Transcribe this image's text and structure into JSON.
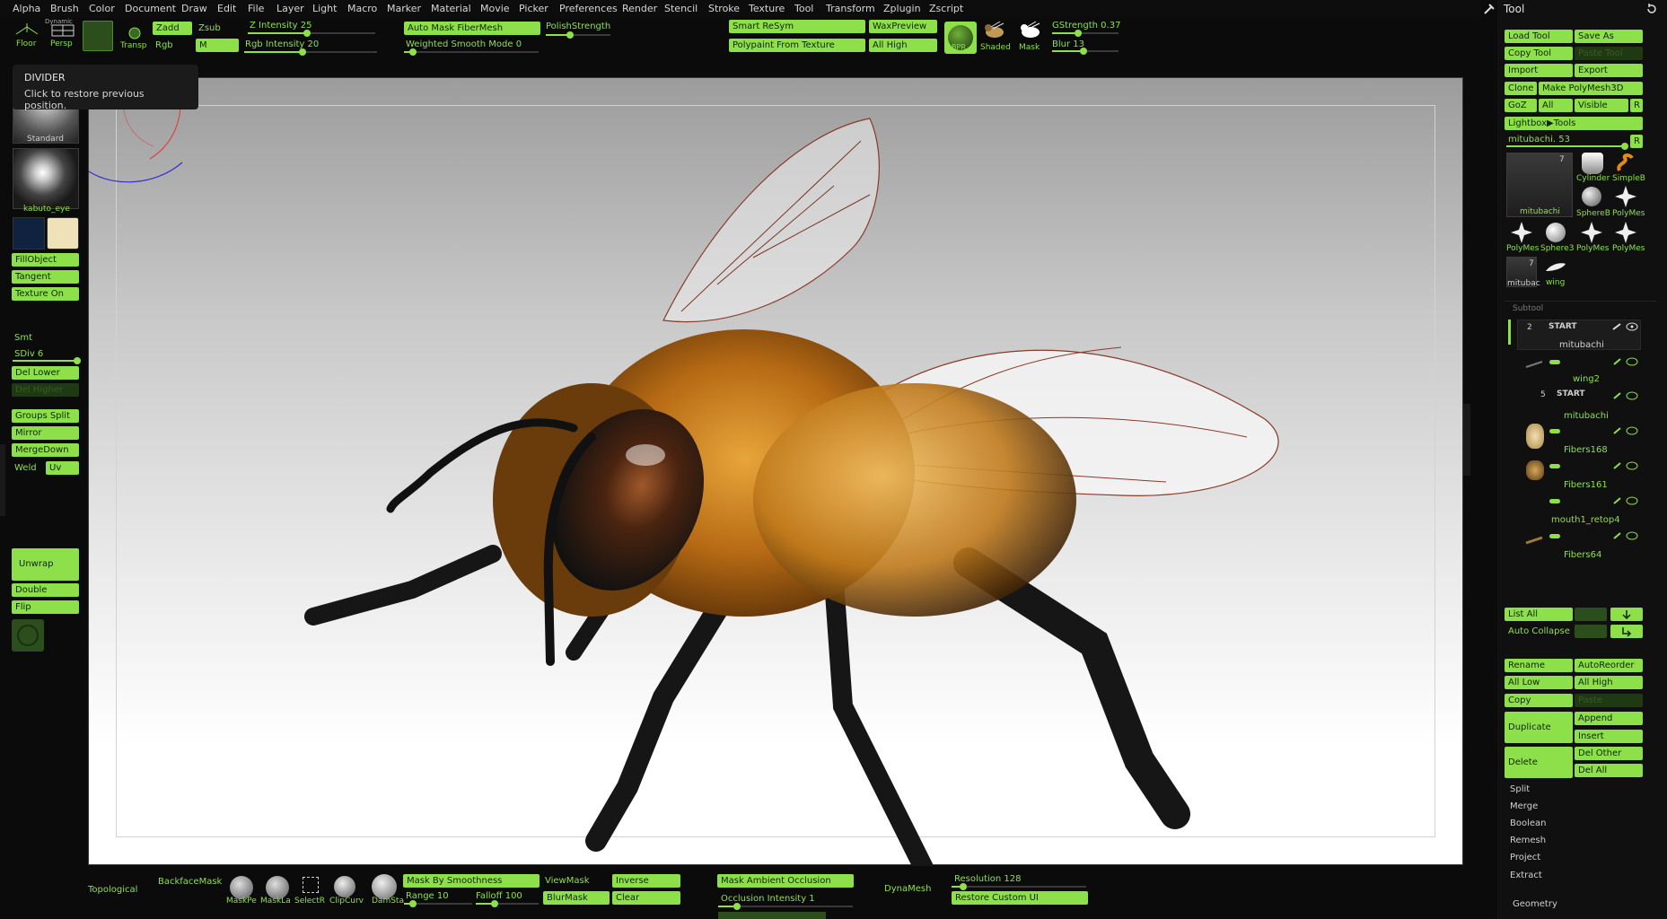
{
  "menu": [
    "Alpha",
    "Brush",
    "Color",
    "Document",
    "Draw",
    "Edit",
    "File",
    "Layer",
    "Light",
    "Macro",
    "Marker",
    "Material",
    "Movie",
    "Picker",
    "Preferences",
    "Render",
    "Stencil",
    "Stroke",
    "Texture",
    "Tool",
    "Transform",
    "Zplugin",
    "Zscript"
  ],
  "top_shelf": {
    "floor": "Floor",
    "persp": "Persp",
    "transp": "Transp",
    "dynamic": "Dynamic",
    "zadd": "Zadd",
    "zsub": "Zsub",
    "rgb": "Rgb",
    "m": "M",
    "z_intensity": "Z Intensity 25",
    "rgb_intensity": "Rgb Intensity 20",
    "auto_mask_fibermesh": "Auto Mask FiberMesh",
    "weighted_smooth_mode": "Weighted Smooth Mode 0",
    "polish_strength": "PolishStrength",
    "smart_resym": "Smart ReSym",
    "polypaint_from_texture": "Polypaint From Texture",
    "wax_preview": "WaxPreview",
    "all_high": "All High",
    "bpr": "BPR",
    "shaded": "Shaded",
    "mask": "Mask",
    "gstrength": "GStrength 0.37",
    "blur": "Blur 13"
  },
  "tooltip": {
    "title": "DIVIDER",
    "text": "Click to restore previous position."
  },
  "left_shelf": {
    "brush_label": "Standard",
    "material_label": "kabuto_eye",
    "fill_object": "FillObject",
    "tangent": "Tangent",
    "texture_on": "Texture On",
    "smt": "Smt",
    "sdiv": "SDiv 6",
    "del_lower": "Del Lower",
    "del_higher": "Del Higher",
    "groups_split": "Groups Split",
    "mirror": "Mirror",
    "merge_down": "MergeDown",
    "weld": "Weld",
    "uv": "Uv",
    "unwrap": "Unwrap",
    "double": "Double",
    "flip": "Flip"
  },
  "bottom_shelf": {
    "topological": "Topological",
    "backface_mask": "BackfaceMask",
    "mask_pen": "MaskPe",
    "mask_lasso": "MaskLa",
    "select_rect": "SelectR",
    "clip_curve": "ClipCurv",
    "dam_standard": "DamSta",
    "mask_by_smoothness": "Mask By Smoothness",
    "range": "Range 10",
    "falloff": "Falloff 100",
    "view_mask": "ViewMask",
    "blur_mask": "BlurMask",
    "inverse": "Inverse",
    "clear": "Clear",
    "mask_ambient_occlusion": "Mask Ambient Occlusion",
    "occlusion_intensity": "Occlusion Intensity 1",
    "dynamesh": "DynaMesh",
    "resolution": "Resolution 128",
    "restore_custom_ui": "Restore Custom UI"
  },
  "tool_panel": {
    "title": "Tool",
    "load_tool": "Load Tool",
    "save_as": "Save As",
    "copy_tool": "Copy Tool",
    "paste_tool": "Paste Tool",
    "import": "Import",
    "export": "Export",
    "clone": "Clone",
    "make_polymesh3d": "Make PolyMesh3D",
    "goz": "GoZ",
    "all": "All",
    "visible": "Visible",
    "r": "R",
    "lightbox_tools": "Lightbox▶Tools",
    "current_tool": "mitubachi. 53",
    "tool_count": "7",
    "tools": [
      "Cylinder",
      "SimpleB",
      "SphereB",
      "PolyMes",
      "PolyMes",
      "Sphere3",
      "PolyMes",
      "PolyMes"
    ],
    "main_tool_label": "mitubachi",
    "small_tool_label": "mitubac",
    "small_tool_count": "7",
    "wing_label": "wing"
  },
  "subtool": {
    "header": "Subtool",
    "start1_num": "2",
    "start1": "START",
    "items": [
      "mitubachi",
      "wing2",
      "mitubachi",
      "Fibers168",
      "Fibers161",
      "mouth1_retop4",
      "Fibers64"
    ],
    "start2_num": "5",
    "start2": "START",
    "list_all": "List All",
    "auto_collapse": "Auto Collapse",
    "rename": "Rename",
    "auto_reorder": "AutoReorder",
    "all_low": "All Low",
    "all_high": "All High",
    "copy": "Copy",
    "paste": "Paste",
    "duplicate": "Duplicate",
    "append": "Append",
    "insert": "Insert",
    "delete": "Delete",
    "del_other": "Del Other",
    "del_all": "Del All",
    "sections": [
      "Split",
      "Merge",
      "Boolean",
      "Remesh",
      "Project",
      "Extract"
    ],
    "geometry": "Geometry"
  },
  "colors": {
    "accent": "#8ee04a",
    "panel": "#101010",
    "background": "#0b0b0b"
  }
}
